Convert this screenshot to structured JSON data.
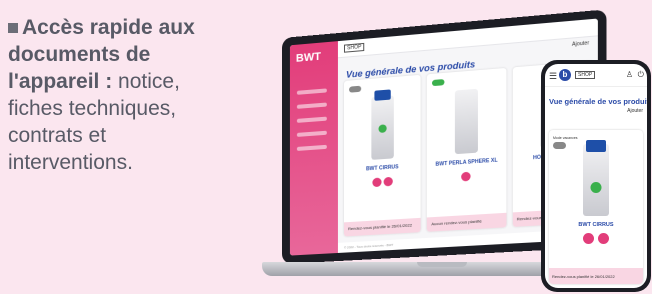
{
  "headline": {
    "bold": "Accès rapide aux documents de l'appareil :",
    "rest": " notice, fiches techniques, contrats et interventions."
  },
  "laptop": {
    "brand": "BWT",
    "shop": "SHOP",
    "title": "Vue générale de vos produits",
    "add": "Ajouter",
    "cards": [
      {
        "name": "BWT CIRRUS",
        "rdv": "Rendez-vous planifié le 26/01/2022",
        "toggle": "off"
      },
      {
        "name": "BWT PERLA SPHERE XL",
        "rdv": "Aucun rendez-vous planifié",
        "toggle": "on"
      },
      {
        "name": "HOSTEMAC PU",
        "rdv": "Rendez-vous planifié le",
        "toggle": "off"
      }
    ],
    "footer": "© 2022 - Tous droits réservés - BWT"
  },
  "phone": {
    "shop": "SHOP",
    "title": "Vue générale de vos produits",
    "add": "Ajouter",
    "mode_label": "Mode vacances",
    "product": "BWT CIRRUS",
    "rdv": "Rendez-vous planifié le 26/01/2022"
  },
  "colors": {
    "background": "#fbe6ef",
    "brand_pink": "#e23d7a",
    "brand_blue": "#2b4ba8"
  }
}
